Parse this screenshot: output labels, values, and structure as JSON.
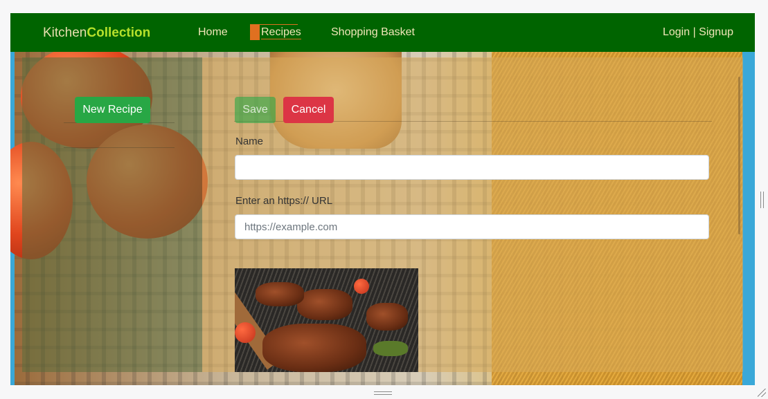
{
  "navbar": {
    "brand_part1": "Kitchen",
    "brand_part2": "Collection",
    "links": [
      {
        "label": "Home"
      },
      {
        "label": "Recipes",
        "active": true
      },
      {
        "label": "Shopping Basket"
      }
    ],
    "auth": "Login | Signup"
  },
  "sidebar": {
    "new_recipe_label": "New Recipe"
  },
  "form": {
    "save_label": "Save",
    "cancel_label": "Cancel",
    "name_label": "Name",
    "name_value": "",
    "url_label": "Enter an https:// URL",
    "url_value": "",
    "url_placeholder": "https://example.com"
  },
  "colors": {
    "navbar_bg": "#006400",
    "brand_accent": "#b5e02b",
    "active_marker": "#e07020",
    "success": "#28a745",
    "danger": "#dc3545"
  },
  "icons": [
    "vertical-resize-handle-icon",
    "horizontal-resize-handle-icon",
    "corner-resize-handle-icon"
  ]
}
